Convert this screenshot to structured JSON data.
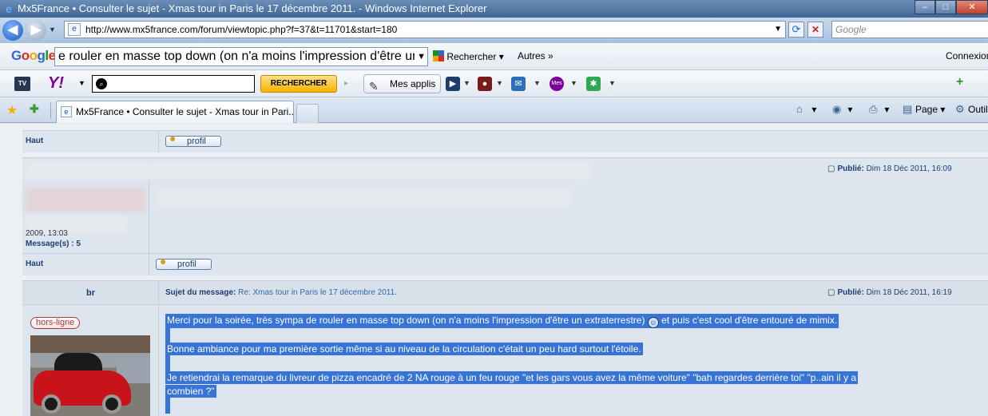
{
  "window": {
    "title": "Mx5France • Consulter le sujet - Xmas tour in Paris le 17 décembre 2011. - Windows Internet Explorer",
    "minimize": "–",
    "maximize": "□",
    "close": "✕"
  },
  "address": {
    "url": "http://www.mx5france.com/forum/viewtopic.php?f=37&t=11701&start=180",
    "search_placeholder": "Google"
  },
  "google_bar": {
    "logo": [
      "G",
      "o",
      "o",
      "g",
      "l",
      "e"
    ],
    "query": "e rouler en masse top down (on n'a moins l'impression d'être un",
    "search_label": "Rechercher",
    "more_label": "Autres »",
    "connect_label": "Connexion"
  },
  "yahoo_bar": {
    "tv_label": "TV",
    "yahoo_label": "Y!",
    "search_button": "RECHERCHER",
    "apps_label": "Mes applis"
  },
  "tabs": {
    "active_label": "Mx5France • Consulter le sujet - Xmas tour in Pari...",
    "page_label": "Page",
    "tools_label": "Outils"
  },
  "forum": {
    "haut_label": "Haut",
    "profile_label": "profil",
    "published_label": "Publié:",
    "post1_date": "Dim 18 Déc 2011, 16:09",
    "post1_partial": "2009, 13:03",
    "post1_msgcount": "Message(s) : 5",
    "post2_author": "br",
    "subject_label": "Sujet du message:",
    "subject_title": "Re: Xmas tour in Paris le 17 décembre 2011.",
    "post2_date": "Dim 18 Déc 2011, 16:19",
    "status_badge": "hors-ligne",
    "para1a": "Merci pour la soirée, très sympa de rouler en masse top down (on n'a moins l'impression d'être un extraterrestre)",
    "para1b": "et puis c'est cool d'être entouré de mimix.",
    "para2": "Bonne ambiance pour ma première sortie même si au niveau de la circulation c'était un peu hard surtout l'étoile.",
    "para3a": "Je retiendrai la remarque du livreur de pizza encadré de 2 NA rouge à un feu rouge \"et les gars vous avez la même voiture\" \"bah regardes derrière toi\" \"p..ain il y a",
    "para3b": "combien ?\""
  }
}
